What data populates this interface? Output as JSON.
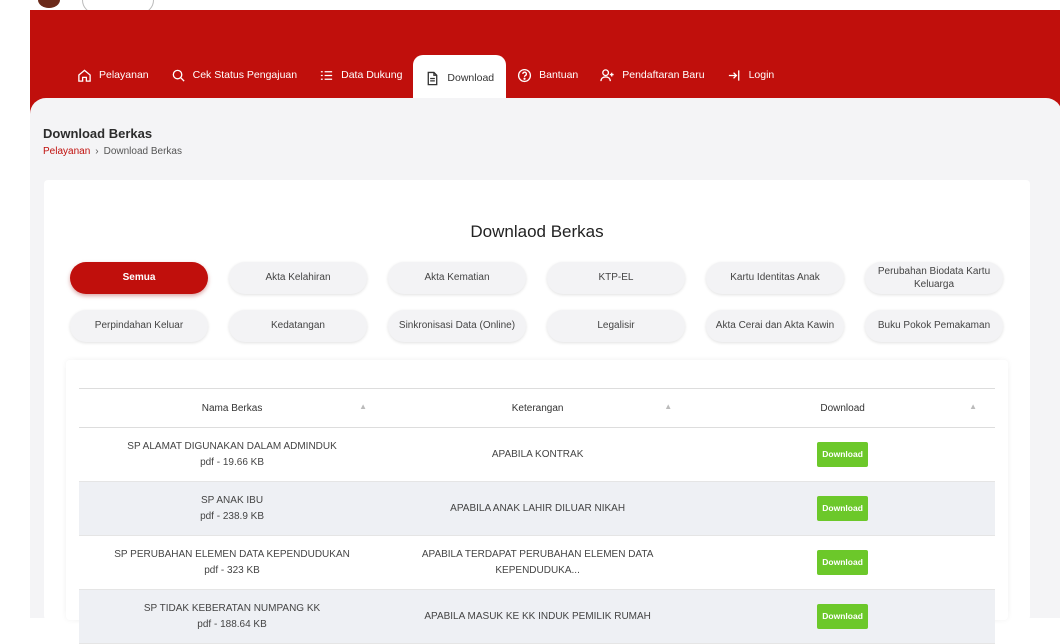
{
  "nav": {
    "items": [
      {
        "label": "Pelayanan",
        "icon": "home-icon"
      },
      {
        "label": "Cek Status Pengajuan",
        "icon": "search-icon"
      },
      {
        "label": "Data Dukung",
        "icon": "list-icon"
      },
      {
        "label": "Download",
        "icon": "document-icon",
        "active": true
      },
      {
        "label": "Bantuan",
        "icon": "help-icon"
      },
      {
        "label": "Pendaftaran Baru",
        "icon": "user-add-icon"
      },
      {
        "label": "Login",
        "icon": "login-icon"
      }
    ]
  },
  "page": {
    "title": "Download Berkas",
    "breadcrumb": {
      "parent": "Pelayanan",
      "separator": "›",
      "current": "Download Berkas"
    }
  },
  "card": {
    "title": "Downlaod Berkas"
  },
  "filters": [
    "Semua",
    "Akta Kelahiran",
    "Akta Kematian",
    "KTP-EL",
    "Kartu Identitas Anak",
    "Perubahan Biodata Kartu Keluarga",
    "Perpindahan Keluar",
    "Kedatangan",
    "Sinkronisasi Data (Online)",
    "Legalisir",
    "Akta Cerai dan Akta Kawin",
    "Buku Pokok Pemakaman"
  ],
  "table": {
    "headers": [
      "Nama Berkas",
      "Keterangan",
      "Download"
    ],
    "sort_glyph": "▲",
    "rows": [
      {
        "name": "SP ALAMAT DIGUNAKAN DALAM ADMINDUK",
        "meta": "pdf - 19.66 KB",
        "desc": "APABILA KONTRAK",
        "button": "Download"
      },
      {
        "name": "SP ANAK IBU",
        "meta": "pdf - 238.9 KB",
        "desc": "APABILA ANAK LAHIR DILUAR NIKAH",
        "button": "Download"
      },
      {
        "name": "SP PERUBAHAN ELEMEN DATA KEPENDUDUKAN",
        "meta": "pdf - 323 KB",
        "desc": "APABILA TERDAPAT PERUBAHAN ELEMEN DATA KEPENDUDUKA...",
        "button": "Download"
      },
      {
        "name": "SP TIDAK KEBERATAN NUMPANG KK",
        "meta": "pdf - 188.64 KB",
        "desc": "APABILA MASUK KE KK INDUK PEMILIK RUMAH",
        "button": "Download"
      }
    ]
  },
  "colors": {
    "brand_red": "#c00f0c",
    "download_green": "#6cc82a",
    "panel_bg": "#f4f4f6"
  }
}
